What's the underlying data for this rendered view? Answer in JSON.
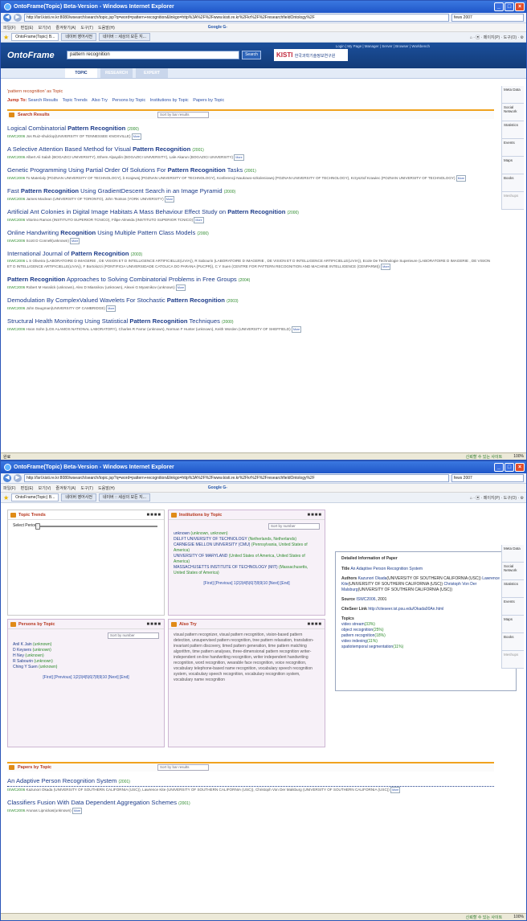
{
  "browser": {
    "title": "OntoFrame(Topic) Beta-Version - Windows Internet Explorer",
    "url": "http://lsrl.kisti.re.kr:8080/wsearch/search/topic.jsp?q=word=pattern+recognition&linkgo=http%3A%2F%2Fwww.kisti.re.kr%2Fkr%2F%2FresearchfieldOntology%2F",
    "search_value": "fews 2007",
    "menu": [
      "파일(F)",
      "편집(E)",
      "보기(V)",
      "즐겨찾기(A)",
      "도구(T)",
      "도움말(H)"
    ],
    "google_label": "Google G-",
    "tabs": [
      "OntoFrame(Topic) B...",
      "네이버 영어사전",
      "네이버 :: 세상의 모든 지..."
    ],
    "tools": "⌂ · ▣ · 페이지(P) · 도구(O) · ⚙",
    "status_left": "완료",
    "status_zone": "신뢰할 수 있는 사이트",
    "zoom": "100%"
  },
  "onto": {
    "top_links": "Login | My Page | Manager | Server | Browser | Workbench",
    "logo": "OntoFrame",
    "query": "pattern recognition",
    "search_button": "Search",
    "kisti_logo": "KISTI",
    "kisti_name": "한국과학기술정보연구원",
    "tabs": [
      "TOPIC",
      "RESEARCH",
      "EXPERT"
    ]
  },
  "sidebar": [
    "Meta Data",
    "Social Network",
    "Statistics",
    "Events",
    "Maps",
    "Books",
    "Meshups"
  ],
  "query_line": "'pattern recognition' as Topic",
  "jump": {
    "label": "Jump To:",
    "links": [
      "Search Results",
      "Topic Trends",
      "Also Try",
      "Persons by Topic",
      "Institutions by Topic",
      "Papers by Topic"
    ]
  },
  "search_results": {
    "title": "Search Results",
    "sort": "Sort by bar results",
    "more": "More",
    "items": [
      {
        "pre": "Logical Combinatorial ",
        "bold": "Pattern Recognition",
        "post": "",
        "year": "(2000)",
        "conf": "ISWC2006",
        "meta": "Jos Ruiz-shulclop(UNIVERSITY OF TENNESSEE KNOXVILLE)"
      },
      {
        "pre": "A Selective Attention Based Method for Visual ",
        "bold": "Pattern Recognition",
        "post": "",
        "year": "(2001)",
        "conf": "ISWC2006",
        "meta": "Albert Ali Salah (BOGAZICI UNIVERSITY), Ethem Alpaydin (BOGAZICI UNIVERSITY), Lale Akarun (BOGAZICI UNIVERSITY)"
      },
      {
        "pre": "Genetic Programming Using Partial Order Of Solutions For ",
        "bold": "Pattern Recognition",
        "post": " Tasks",
        "year": "(2001)",
        "conf": "ISWC2006",
        "meta": "To Materialy (POZNAN UNIVERSITY OF TECHNOLOGY), b Krajewsj (POZNAN UNIVERSITY OF TECHNOLOGY), Konferencji Naukowo-szkoleniowej (POZNAN UNIVERSITY OF TECHNOLOGY), Krzysztof Krawiec (POZNAN UNIVERSITY OF TECHNOLOGY)"
      },
      {
        "pre": "Fast ",
        "bold": "Pattern Recognition",
        "post": " Using GradientDescent Search in an Image Pyramid",
        "year": "(2000)",
        "conf": "ISWC2006",
        "meta": "James Maclean (UNIVERSITY OF TORONTO), John Tsotsos (YORK UNIVERSITY)"
      },
      {
        "pre": "Artificial Ant Colonies in Digital Image Habitats A Mass Behaviour Effect Study on ",
        "bold": "Pattern Recognition",
        "post": "",
        "year": "(2000)",
        "conf": "ISWC2006",
        "meta": "Vitorino Ramos (INSTITUTO SUPERIOR TCNICO), Filipe Almeida (INSTITUTO SUPERIOR TCNICO)"
      },
      {
        "pre": "Online Handwriting ",
        "bold": "Recognition",
        "post": " Using Multiple Pattern Class Models",
        "year": "(2000)",
        "conf": "ISWC2006",
        "meta": "Scott D Connell(unknown)"
      },
      {
        "pre": "International Journal of ",
        "bold": "Pattern Recognition",
        "post": "",
        "year": "(2003)",
        "conf": "ISWC2006",
        "meta": "L S Oliveira (LABORATOIRE D IMAGERIE , DE VISION ET D INTELLIGENCE ARTIFICIELLE(LIVIA)), R Sabourin (LABORATOIRE D IMAGERIE , DE VISION ET D INTELLIGENCE ARTIFICIELLE(LIVIA)), Ecole De Technologie Superieure (LABORATOIRE D IMAGERIE , DE VISION ET D INTELLIGENCE ARTIFICIELLE(LIVIA)), F Bortolozzi (PONTIFICIA UNIVERSIDADE CATOLICA DO PARANA (PUCPR)), C Y Suen (CENTRE FOR PATTERN RECOGNITION AND MACHINE INTELLIGENCE (CENPARMI))"
      },
      {
        "pre": "",
        "bold": "Pattern Recognition",
        "post": " Approaches to Solving Combinatorial Problems in Free Groups",
        "year": "(2004)",
        "conf": "ISWC2006",
        "meta": "Robert M Haralick (unknown), Alex D Miasnikov (unknown), Alexei G Myasnikov (unknown)"
      },
      {
        "pre": "Demodulation By ComplexValued Wavelets For Stochastic ",
        "bold": "Pattern Recognition",
        "post": "",
        "year": "(2003)",
        "conf": "ISWC2006",
        "meta": "John Daugman(UNIVERSITY OF CAMBRIDGE)"
      },
      {
        "pre": "Structural Health Monitoring Using Statistical ",
        "bold": "Pattern Recognition",
        "post": " Techniques",
        "year": "(2000)",
        "conf": "ISWC2006",
        "meta": "Hoon Sohn (LOS ALAMOS NATIONAL LABORATORY), Charles R Farrar (unknown), Norman F Hunter (unknown), Keith Worden (UNIVERSITY OF SHEFFIELD)"
      }
    ]
  },
  "topic_trends": {
    "title": "Topic Trends",
    "period_label": "Select Period"
  },
  "institutions": {
    "title": "Institutions by Topic",
    "sort": "Sort by number",
    "items": [
      {
        "name": "unknown",
        "loc": "(unknown, unknown)"
      },
      {
        "name": "DELFT UNIVERSITY OF TECHNOLOGY",
        "loc": "(Netherlands, Netherlands)"
      },
      {
        "name": "CARNEGIE MELLON UNIVERSITY (CMU)",
        "loc": "(Pennsylvania, United States of America)"
      },
      {
        "name": "UNIVERSITY OF MARYLAND",
        "loc": "(United States of America, United States of America)"
      },
      {
        "name": "MASSACHUSETTS INSTITUTE OF TECHNOLOGY (MIT)",
        "loc": "(Massachusetts, United States of America)"
      }
    ],
    "pager": "[First] [Previous] 1|2|3|4|5|6|7|8|9|10 [Next] [End]"
  },
  "persons": {
    "title": "Persons by Topic",
    "sort": "Sort by number",
    "items": [
      {
        "name": "Anil K Jain",
        "aff": "(unknown)"
      },
      {
        "name": "D Keysers",
        "aff": "(unknown)"
      },
      {
        "name": "H Ney",
        "aff": "(unknown)"
      },
      {
        "name": "R Sabourin",
        "aff": "(unknown)"
      },
      {
        "name": "Ching Y Suen",
        "aff": "(unknown)"
      }
    ],
    "pager": "[First] [Previous] 1|2|3|4|5|6|7|8|9|10 [Next] [End]"
  },
  "also_try": {
    "title": "Also Try",
    "text": "visual pattern recognizer, visual pattern recognition, vision-based pattern detection, unsupervised pattern recognition, tree pattern relaxation, translation-invariant pattern discovery, timed pattern generation, time pattern matching algorithm, time pattern analyses, three-dimensional pattern recognition writer-independent on-line handwriting recognition, writer independent handwriting recognition, word recognition, wearable face recognition, voice recognition, vocabulary telephone-based name recognition, vocabulary speech recognition system, vocabulary speech recognition, vocabulary recognition system, vocabulary name recognition"
  },
  "detail": {
    "heading": "Detailed Information of Paper",
    "title_label": "Title",
    "title_value": "An Adaptive Person Recognition System",
    "authors_label": "Authors",
    "authors_1": "Kazunori Okada",
    "authors_1_aff": "(UNIVERSITY OF SOUTHERN CALIFORNIA (USC))",
    "authors_2": "Lawrence Kite",
    "authors_2_aff": "(UNIVERSITY OF SOUTHERN CALIFORNIA (USC))",
    "authors_3": "Christoph Von Der Malsburg",
    "authors_3_aff": "(UNIVERSITY OF SOUTHERN CALIFORNIA (USC))",
    "source_label": "Source",
    "source_value": "ISWC2006",
    "source_year": ", 2001",
    "citeseer_label": "CiteSeer Link",
    "citeseer_value": "http://citeseer.ist.psu.edu/Okada00An.html",
    "topics_label": "Topics",
    "topics": [
      {
        "name": "video stream",
        "pct": "(33%)"
      },
      {
        "name": "object recognition",
        "pct": "(25%)"
      },
      {
        "name": "pattern recognition",
        "pct": "(18%)"
      },
      {
        "name": "video indexing",
        "pct": "(11%)"
      },
      {
        "name": "spatiotemporal segmentation",
        "pct": "(11%)"
      }
    ]
  },
  "papers": {
    "title": "Papers by Topic",
    "sort": "Sort by bar results",
    "items": [
      {
        "title": "An Adaptive Person Recognition System",
        "year": "(2001)",
        "conf": "ISWC2006",
        "meta": "Kazunori Okada (UNIVERSITY OF SOUTHERN CALIFORNIA (USC)), Lawrence Kite (UNIVERSITY OF SOUTHERN CALIFORNIA (USC)), Christoph Von Der Malsburg (UNIVERSITY OF SOUTHERN CALIFORNIA (USC))"
      },
      {
        "title": "Classifiers Fusion With Data Dependent Aggregation Schemes",
        "year": "(2001)",
        "conf": "ISWC2006",
        "meta": "Arunas Lipnickas(unknown)"
      }
    ]
  }
}
